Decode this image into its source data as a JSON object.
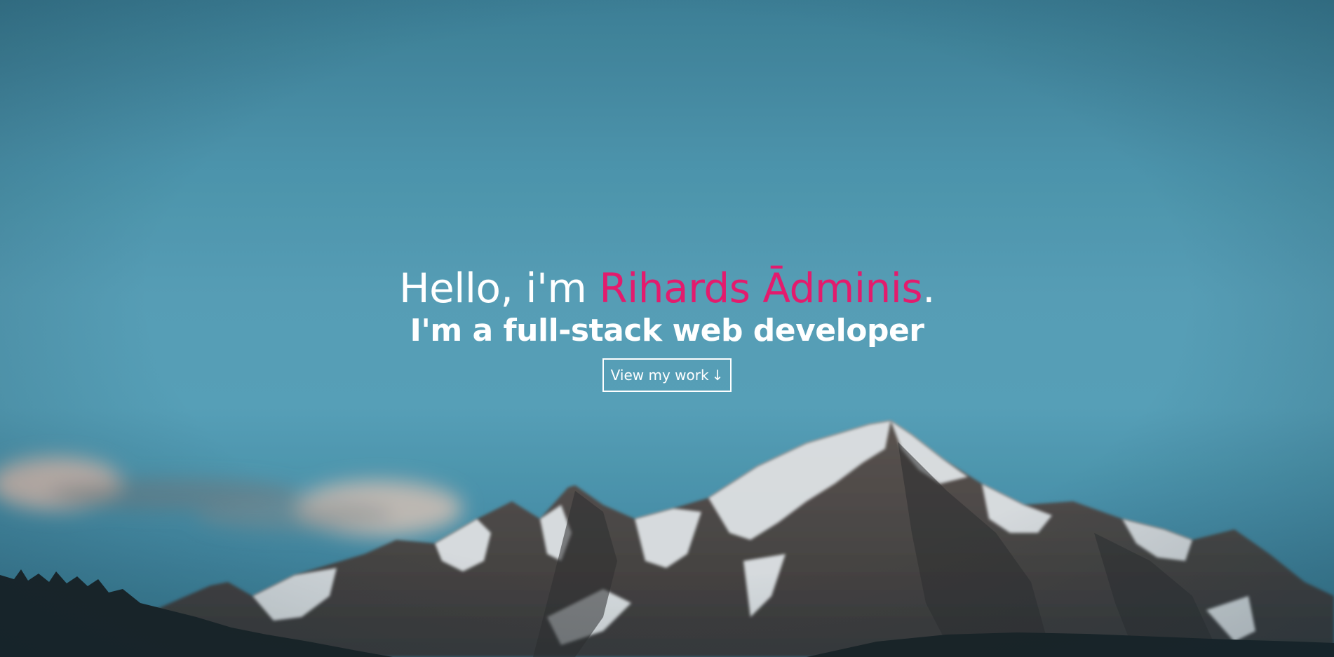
{
  "hero": {
    "greeting": "Hello, i'm ",
    "name": "Rihards Ādminis",
    "name_suffix": ".",
    "subtitle": "I'm a full-stack web developer",
    "cta_label": "View my work",
    "cta_icon": "↓"
  },
  "colors": {
    "accent": "#e31b6d",
    "text": "#ffffff",
    "sky": "#5aa3bb"
  }
}
